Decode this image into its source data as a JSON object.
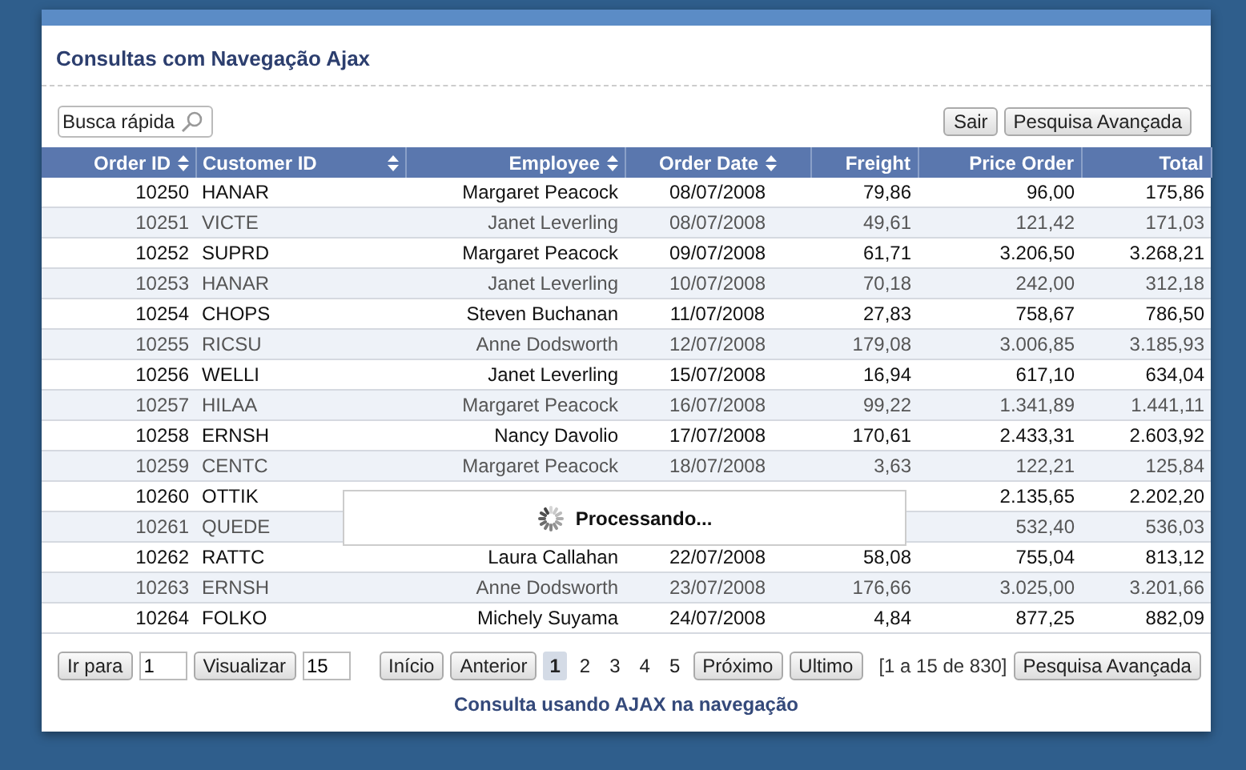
{
  "title": "Consultas com Navegação Ajax",
  "search": {
    "placeholder": "Busca rápida"
  },
  "toolbar_buttons": [
    "Sair",
    "Pesquisa Avançada"
  ],
  "columns": [
    {
      "label": "Order ID",
      "sortable": true
    },
    {
      "label": "Customer ID",
      "sortable": true
    },
    {
      "label": "Employee",
      "sortable": true
    },
    {
      "label": "Order Date",
      "sortable": true
    },
    {
      "label": "Freight",
      "sortable": false
    },
    {
      "label": "Price Order",
      "sortable": false
    },
    {
      "label": "Total",
      "sortable": false
    }
  ],
  "rows": [
    [
      "10250",
      "HANAR",
      "Margaret Peacock",
      "08/07/2008",
      "79,86",
      "96,00",
      "175,86"
    ],
    [
      "10251",
      "VICTE",
      "Janet Leverling",
      "08/07/2008",
      "49,61",
      "121,42",
      "171,03"
    ],
    [
      "10252",
      "SUPRD",
      "Margaret Peacock",
      "09/07/2008",
      "61,71",
      "3.206,50",
      "3.268,21"
    ],
    [
      "10253",
      "HANAR",
      "Janet Leverling",
      "10/07/2008",
      "70,18",
      "242,00",
      "312,18"
    ],
    [
      "10254",
      "CHOPS",
      "Steven Buchanan",
      "11/07/2008",
      "27,83",
      "758,67",
      "786,50"
    ],
    [
      "10255",
      "RICSU",
      "Anne Dodsworth",
      "12/07/2008",
      "179,08",
      "3.006,85",
      "3.185,93"
    ],
    [
      "10256",
      "WELLI",
      "Janet Leverling",
      "15/07/2008",
      "16,94",
      "617,10",
      "634,04"
    ],
    [
      "10257",
      "HILAA",
      "Margaret Peacock",
      "16/07/2008",
      "99,22",
      "1.341,89",
      "1.441,11"
    ],
    [
      "10258",
      "ERNSH",
      "Nancy Davolio",
      "17/07/2008",
      "170,61",
      "2.433,31",
      "2.603,92"
    ],
    [
      "10259",
      "CENTC",
      "Margaret Peacock",
      "18/07/2008",
      "3,63",
      "122,21",
      "125,84"
    ],
    [
      "10260",
      "OTTIK",
      "",
      "",
      "",
      "2.135,65",
      "2.202,20"
    ],
    [
      "10261",
      "QUEDE",
      "",
      "",
      "",
      "532,40",
      "536,03"
    ],
    [
      "10262",
      "RATTC",
      "Laura Callahan",
      "22/07/2008",
      "58,08",
      "755,04",
      "813,12"
    ],
    [
      "10263",
      "ERNSH",
      "Anne Dodsworth",
      "23/07/2008",
      "176,66",
      "3.025,00",
      "3.201,66"
    ],
    [
      "10264",
      "FOLKO",
      "Michely Suyama",
      "24/07/2008",
      "4,84",
      "877,25",
      "882,09"
    ]
  ],
  "loading": {
    "text": "Processando..."
  },
  "footer": {
    "goto_label": "Ir para",
    "goto_value": "1",
    "view_label": "Visualizar",
    "view_value": "15",
    "first": "Início",
    "prev": "Anterior",
    "pages": [
      {
        "label": "1",
        "selected": true
      },
      {
        "label": "2",
        "selected": false
      },
      {
        "label": "3",
        "selected": false
      },
      {
        "label": "4",
        "selected": false
      },
      {
        "label": "5",
        "selected": false
      }
    ],
    "next": "Próximo",
    "last": "Ultimo",
    "range": "[1 a 15 de 830]",
    "advanced": "Pesquisa Avançada"
  },
  "caption": "Consulta usando AJAX na navegação"
}
